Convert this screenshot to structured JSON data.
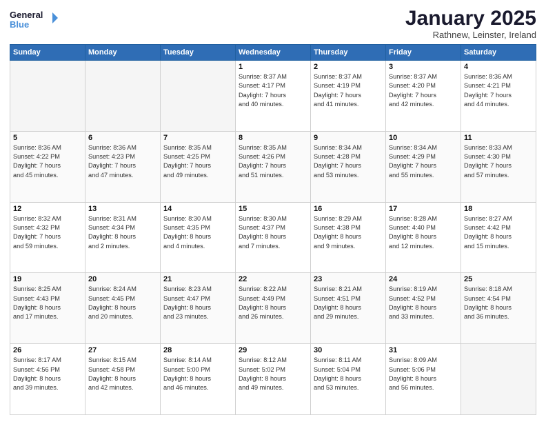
{
  "logo": {
    "line1": "General",
    "line2": "Blue"
  },
  "title": "January 2025",
  "subtitle": "Rathnew, Leinster, Ireland",
  "weekdays": [
    "Sunday",
    "Monday",
    "Tuesday",
    "Wednesday",
    "Thursday",
    "Friday",
    "Saturday"
  ],
  "weeks": [
    [
      {
        "num": "",
        "content": ""
      },
      {
        "num": "",
        "content": ""
      },
      {
        "num": "",
        "content": ""
      },
      {
        "num": "1",
        "content": "Sunrise: 8:37 AM\nSunset: 4:17 PM\nDaylight: 7 hours\nand 40 minutes."
      },
      {
        "num": "2",
        "content": "Sunrise: 8:37 AM\nSunset: 4:19 PM\nDaylight: 7 hours\nand 41 minutes."
      },
      {
        "num": "3",
        "content": "Sunrise: 8:37 AM\nSunset: 4:20 PM\nDaylight: 7 hours\nand 42 minutes."
      },
      {
        "num": "4",
        "content": "Sunrise: 8:36 AM\nSunset: 4:21 PM\nDaylight: 7 hours\nand 44 minutes."
      }
    ],
    [
      {
        "num": "5",
        "content": "Sunrise: 8:36 AM\nSunset: 4:22 PM\nDaylight: 7 hours\nand 45 minutes."
      },
      {
        "num": "6",
        "content": "Sunrise: 8:36 AM\nSunset: 4:23 PM\nDaylight: 7 hours\nand 47 minutes."
      },
      {
        "num": "7",
        "content": "Sunrise: 8:35 AM\nSunset: 4:25 PM\nDaylight: 7 hours\nand 49 minutes."
      },
      {
        "num": "8",
        "content": "Sunrise: 8:35 AM\nSunset: 4:26 PM\nDaylight: 7 hours\nand 51 minutes."
      },
      {
        "num": "9",
        "content": "Sunrise: 8:34 AM\nSunset: 4:28 PM\nDaylight: 7 hours\nand 53 minutes."
      },
      {
        "num": "10",
        "content": "Sunrise: 8:34 AM\nSunset: 4:29 PM\nDaylight: 7 hours\nand 55 minutes."
      },
      {
        "num": "11",
        "content": "Sunrise: 8:33 AM\nSunset: 4:30 PM\nDaylight: 7 hours\nand 57 minutes."
      }
    ],
    [
      {
        "num": "12",
        "content": "Sunrise: 8:32 AM\nSunset: 4:32 PM\nDaylight: 7 hours\nand 59 minutes."
      },
      {
        "num": "13",
        "content": "Sunrise: 8:31 AM\nSunset: 4:34 PM\nDaylight: 8 hours\nand 2 minutes."
      },
      {
        "num": "14",
        "content": "Sunrise: 8:30 AM\nSunset: 4:35 PM\nDaylight: 8 hours\nand 4 minutes."
      },
      {
        "num": "15",
        "content": "Sunrise: 8:30 AM\nSunset: 4:37 PM\nDaylight: 8 hours\nand 7 minutes."
      },
      {
        "num": "16",
        "content": "Sunrise: 8:29 AM\nSunset: 4:38 PM\nDaylight: 8 hours\nand 9 minutes."
      },
      {
        "num": "17",
        "content": "Sunrise: 8:28 AM\nSunset: 4:40 PM\nDaylight: 8 hours\nand 12 minutes."
      },
      {
        "num": "18",
        "content": "Sunrise: 8:27 AM\nSunset: 4:42 PM\nDaylight: 8 hours\nand 15 minutes."
      }
    ],
    [
      {
        "num": "19",
        "content": "Sunrise: 8:25 AM\nSunset: 4:43 PM\nDaylight: 8 hours\nand 17 minutes."
      },
      {
        "num": "20",
        "content": "Sunrise: 8:24 AM\nSunset: 4:45 PM\nDaylight: 8 hours\nand 20 minutes."
      },
      {
        "num": "21",
        "content": "Sunrise: 8:23 AM\nSunset: 4:47 PM\nDaylight: 8 hours\nand 23 minutes."
      },
      {
        "num": "22",
        "content": "Sunrise: 8:22 AM\nSunset: 4:49 PM\nDaylight: 8 hours\nand 26 minutes."
      },
      {
        "num": "23",
        "content": "Sunrise: 8:21 AM\nSunset: 4:51 PM\nDaylight: 8 hours\nand 29 minutes."
      },
      {
        "num": "24",
        "content": "Sunrise: 8:19 AM\nSunset: 4:52 PM\nDaylight: 8 hours\nand 33 minutes."
      },
      {
        "num": "25",
        "content": "Sunrise: 8:18 AM\nSunset: 4:54 PM\nDaylight: 8 hours\nand 36 minutes."
      }
    ],
    [
      {
        "num": "26",
        "content": "Sunrise: 8:17 AM\nSunset: 4:56 PM\nDaylight: 8 hours\nand 39 minutes."
      },
      {
        "num": "27",
        "content": "Sunrise: 8:15 AM\nSunset: 4:58 PM\nDaylight: 8 hours\nand 42 minutes."
      },
      {
        "num": "28",
        "content": "Sunrise: 8:14 AM\nSunset: 5:00 PM\nDaylight: 8 hours\nand 46 minutes."
      },
      {
        "num": "29",
        "content": "Sunrise: 8:12 AM\nSunset: 5:02 PM\nDaylight: 8 hours\nand 49 minutes."
      },
      {
        "num": "30",
        "content": "Sunrise: 8:11 AM\nSunset: 5:04 PM\nDaylight: 8 hours\nand 53 minutes."
      },
      {
        "num": "31",
        "content": "Sunrise: 8:09 AM\nSunset: 5:06 PM\nDaylight: 8 hours\nand 56 minutes."
      },
      {
        "num": "",
        "content": ""
      }
    ]
  ]
}
